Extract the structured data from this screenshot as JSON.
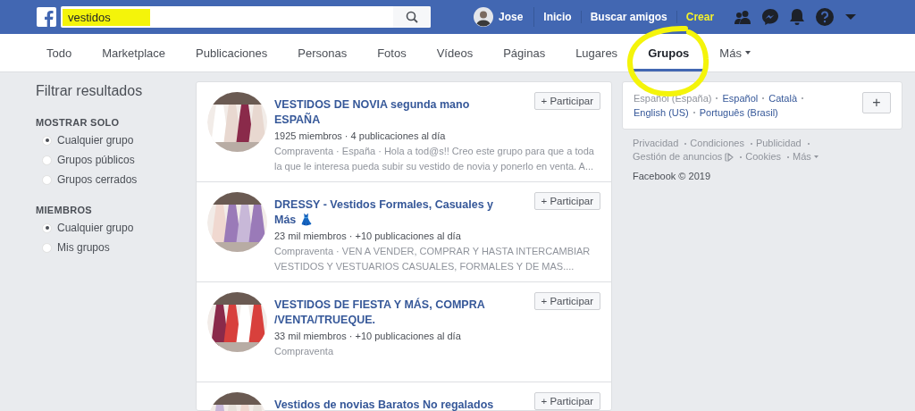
{
  "top_bar": {
    "search": {
      "value": "vestidos",
      "highlighted": true
    },
    "user": {
      "name": "Jose"
    },
    "nav": [
      "Inicio",
      "Buscar amigos",
      "Crear"
    ]
  },
  "tabs": [
    {
      "label": "Todo",
      "selected": false,
      "circled": false
    },
    {
      "label": "Marketplace",
      "selected": false,
      "circled": false
    },
    {
      "label": "Publicaciones",
      "selected": false,
      "circled": false
    },
    {
      "label": "Personas",
      "selected": false,
      "circled": false
    },
    {
      "label": "Fotos",
      "selected": false,
      "circled": false
    },
    {
      "label": "Vídeos",
      "selected": false,
      "circled": false
    },
    {
      "label": "Páginas",
      "selected": false,
      "circled": false
    },
    {
      "label": "Lugares",
      "selected": false,
      "circled": false
    },
    {
      "label": "Grupos",
      "selected": true,
      "circled": true
    },
    {
      "label": "Más",
      "selected": false,
      "circled": false,
      "dropdown": true
    }
  ],
  "filters": {
    "title": "Filtrar resultados",
    "sections": [
      {
        "heading": "MOSTRAR SOLO",
        "options": [
          {
            "label": "Cualquier grupo",
            "selected": true
          },
          {
            "label": "Grupos públicos",
            "selected": false
          },
          {
            "label": "Grupos cerrados",
            "selected": false
          }
        ]
      },
      {
        "heading": "MIEMBROS",
        "options": [
          {
            "label": "Cualquier grupo",
            "selected": true
          },
          {
            "label": "Mis grupos",
            "selected": false
          }
        ]
      }
    ]
  },
  "results": [
    {
      "title": "VESTIDOS DE NOVIA segunda mano ESPAÑA",
      "meta": "1925 miembros · 4 publicaciones al día",
      "description": "Compraventa · España · Hola a tod@s!! Creo este grupo para que a toda la que le interesa pueda subir su vestido de novia y ponerlo en venta. A...",
      "button": "+ Participar",
      "color": "#e8d8d0"
    },
    {
      "title": "DRESSY - Vestidos Formales, Casuales y Más",
      "emoji": "👗",
      "meta": "23 mil miembros · +10 publicaciones al día",
      "description": "Compraventa · VEN A VENDER, COMPRAR Y HASTA INTERCAMBIAR VESTIDOS Y VESTUARIOS CASUALES, FORMALES Y DE MAS....",
      "button": "+ Participar",
      "color": "#9a7ab8"
    },
    {
      "title": "VESTIDOS DE FIESTA Y MÁS, COMPRA /VENTA/TRUEQUE.",
      "meta": "33 mil miembros · +10 publicaciones al día",
      "description": "Compraventa",
      "button": "+ Participar",
      "color": "#d8403c"
    },
    {
      "title": "Vestidos de novias Baratos No regalados",
      "button": "+ Participar",
      "color": "#e6e0da"
    }
  ],
  "languages": [
    {
      "label": "Español (España)",
      "selected": true
    },
    {
      "label": "Español",
      "selected": false
    },
    {
      "label": "Català",
      "selected": false
    },
    {
      "label": "English (US)",
      "selected": false
    },
    {
      "label": "Português (Brasil)",
      "selected": false
    }
  ],
  "add_language_button": "+",
  "footer_links": [
    {
      "label": "Privacidad"
    },
    {
      "label": "Condiciones"
    },
    {
      "label": "Publicidad"
    },
    {
      "label": "Gestión de anuncios",
      "ad_icon": true
    },
    {
      "label": "Cookies"
    },
    {
      "label": "Más",
      "dropdown": true
    }
  ],
  "copyright": "Facebook © 2019"
}
